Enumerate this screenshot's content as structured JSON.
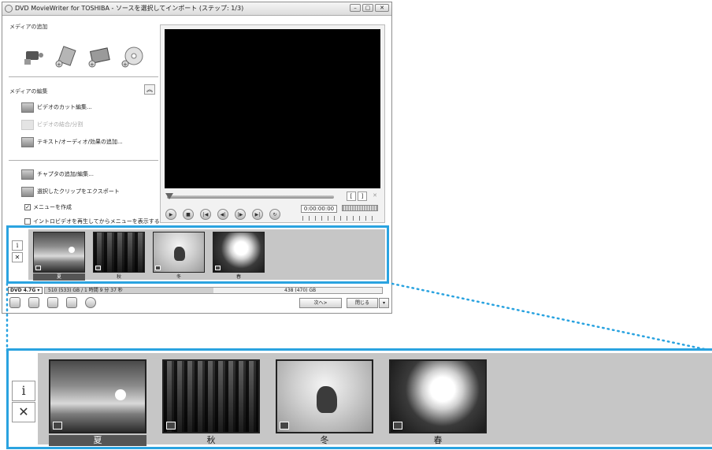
{
  "window": {
    "title": "DVD MovieWriter for TOSHIBA - ソースを選択してインポート (ステップ: 1/3)"
  },
  "left_panel": {
    "add_media_title": "メディアの追加",
    "add_media_icons": [
      "camcorder-icon",
      "add-video-icon",
      "add-photo-icon",
      "add-disc-icon"
    ],
    "edit_media_title": "メディアの編集",
    "tasks": [
      {
        "label": "ビデオのカット編集...",
        "enabled": true
      },
      {
        "label": "ビデオの結合/分割",
        "enabled": false
      },
      {
        "label": "テキスト/オーディオ/効果の追加...",
        "enabled": true
      },
      {
        "label": "チャプタの追加/編集...",
        "enabled": true
      },
      {
        "label": "選択したクリップをエクスポート",
        "enabled": true
      }
    ],
    "checkbox_menu": {
      "label": "メニューを作成",
      "checked": true
    },
    "checkbox_intro": {
      "label": "イントロビデオを再生してからメニューを表示する",
      "checked": false
    }
  },
  "player": {
    "timecode": "0:00:00:00",
    "mark_in": "[",
    "mark_out": "]",
    "cut": "✕"
  },
  "storyboard": {
    "info_label": "i",
    "delete_label": "✕",
    "clips": [
      {
        "label": "夏",
        "selected": true
      },
      {
        "label": "秋",
        "selected": false
      },
      {
        "label": "冬",
        "selected": false
      },
      {
        "label": "春",
        "selected": false
      }
    ]
  },
  "status": {
    "disc_type": "DVD 4.7G ▾",
    "used": "510 (533) GB / 1 時間 9 分 37 秒",
    "total": "438 (470) GB"
  },
  "buttons": {
    "next": "次へ>",
    "close": "閉じる"
  },
  "colors": {
    "highlight_border": "#2aa3e0",
    "storyboard_bg": "#c6c6c6",
    "video_bg": "#000000"
  }
}
